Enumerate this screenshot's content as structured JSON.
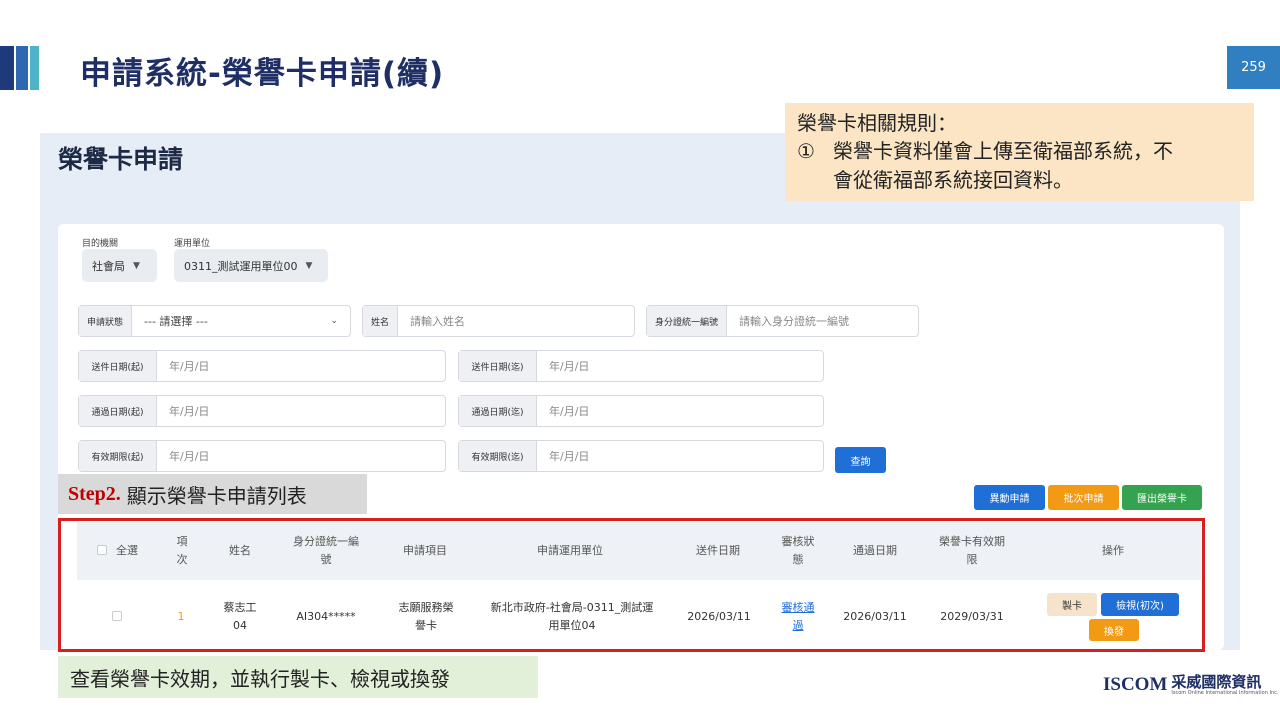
{
  "slide": {
    "title": "申請系統-榮譽卡申請(續)",
    "page_number": "259"
  },
  "app": {
    "title": "榮譽卡申請"
  },
  "rules": {
    "title": "榮譽卡相關規則：",
    "item_num": "①",
    "item_text_1": "榮譽卡資料僅會上傳至衛福部系統，不",
    "item_text_2": "會從衛福部系統接回資料。"
  },
  "filters": {
    "org_label": "目的機關",
    "org_value": "社會局",
    "unit_label": "運用單位",
    "unit_value": "0311_測試運用單位00",
    "status_label": "申請狀態",
    "status_value": "--- 請選擇 ---",
    "name_label": "姓名",
    "name_placeholder": "請輸入姓名",
    "id_label": "身分證統一編號",
    "id_placeholder": "請輸入身分證統一編號",
    "send_start_label": "送件日期(起)",
    "send_end_label": "送件日期(迄)",
    "pass_start_label": "通過日期(起)",
    "pass_end_label": "通過日期(迄)",
    "valid_start_label": "有效期限(起)",
    "valid_end_label": "有效期限(迄)",
    "date_placeholder": "年/月/日",
    "search_button": "查詢"
  },
  "actions": {
    "change_apply": "異動申請",
    "batch_apply": "批次申請",
    "export_card": "匯出榮譽卡"
  },
  "step": {
    "label": "Step2.",
    "text": "顯示榮譽卡申請列表"
  },
  "table": {
    "headers": {
      "select_all": "全選",
      "index_1": "項",
      "index_2": "次",
      "name": "姓名",
      "id_1": "身分證統一編",
      "id_2": "號",
      "item": "申請項目",
      "unit": "申請運用單位",
      "send_date": "送件日期",
      "status_1": "審核狀",
      "status_2": "態",
      "pass_date": "通過日期",
      "expiry_1": "榮譽卡有效期",
      "expiry_2": "限",
      "ops": "操作"
    },
    "rows": [
      {
        "index": "1",
        "name_1": "蔡志工",
        "name_2": "04",
        "id": "AI304*****",
        "item_1": "志願服務榮",
        "item_2": "譽卡",
        "unit_1": "新北市政府-社會局-0311_測試運",
        "unit_2": "用單位04",
        "send_date": "2026/03/11",
        "status_1": "審核通",
        "status_2": "過",
        "pass_date": "2026/03/11",
        "expiry": "2029/03/31",
        "op_make": "製卡",
        "op_view": "檢視(初次)",
        "op_reissue": "換發"
      }
    ]
  },
  "summary": {
    "text": "查看榮譽卡效期，並執行製卡、檢視或換發"
  },
  "logo": {
    "iscom": "ISCOM",
    "cn": "采威國際資訊",
    "sub": "Iscom Online International Information Inc."
  }
}
